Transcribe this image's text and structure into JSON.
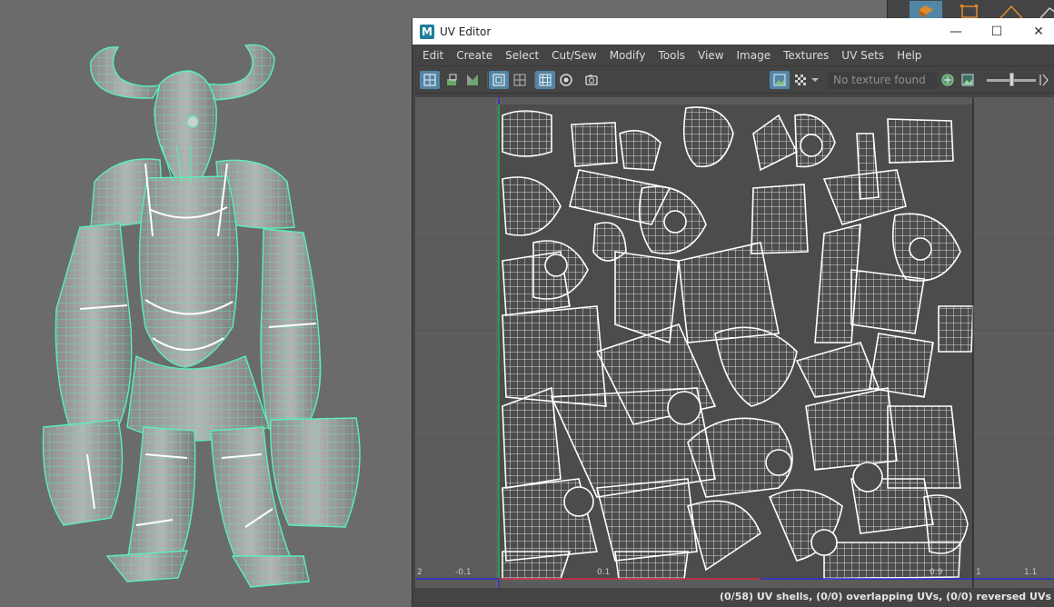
{
  "window": {
    "title": "UV Editor",
    "app_icon_letter": "M"
  },
  "menu": [
    "Edit",
    "Create",
    "Select",
    "Cut/Sew",
    "Modify",
    "Tools",
    "View",
    "Image",
    "Textures",
    "UV Sets",
    "Help"
  ],
  "toolbar": {
    "texture_field": "No texture found",
    "left_icons": [
      "uv-shell-icon",
      "uv-shell-alt-icon",
      "uv-distort-icon",
      "frame-icon",
      "grid-icon",
      "checker-select-icon",
      "circle-dot-icon",
      "snapshot-icon"
    ],
    "right_icons": [
      "image-display-icon",
      "checker-icon",
      "dropdown-arrow-icon",
      "texture-icon",
      "image-toggle-icon",
      "next-icon"
    ]
  },
  "axis_labels": {
    "neg2": "2",
    "neg01": "-0.1",
    "v01": "0.1",
    "v09": "0.9",
    "v1": "1",
    "v11": "1.1"
  },
  "status": {
    "text": "(0/58) UV shells, (0/0) overlapping UVs, (0/0) reversed UVs"
  },
  "colors": {
    "wireframe": "#5af0b6",
    "uv_lines": "#ffffff",
    "u_axis": "#2b2bd6",
    "v_axis": "#1fbf3a",
    "accent": "#5285a6"
  }
}
